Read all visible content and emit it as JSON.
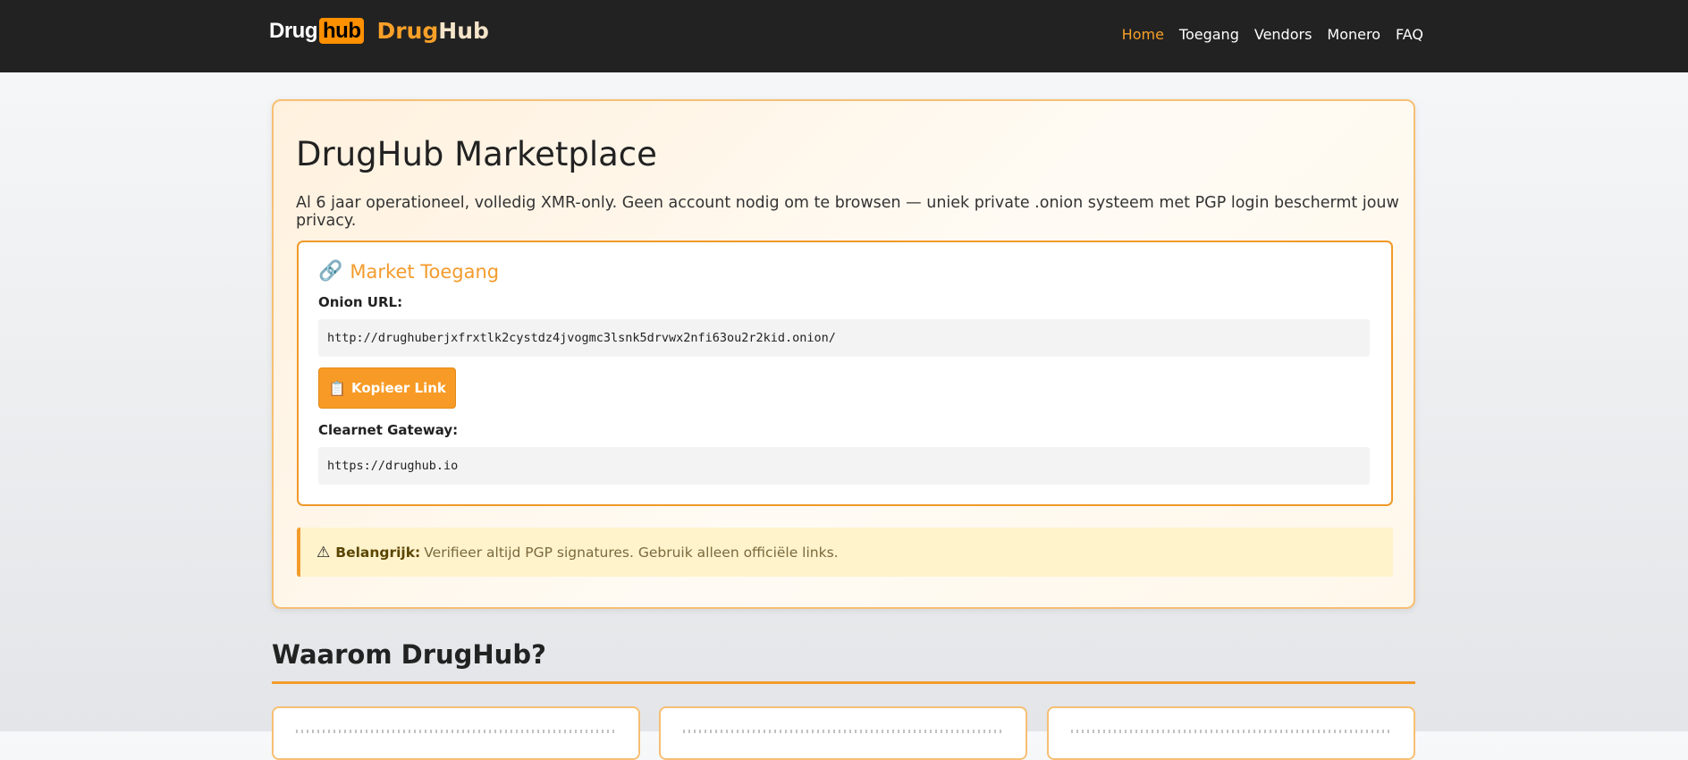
{
  "header": {
    "logo_drug": "Drug",
    "logo_hub": "hub",
    "brand_part1": "Drug",
    "brand_part2": "Hub",
    "nav": [
      {
        "label": "Home",
        "active": true
      },
      {
        "label": "Toegang",
        "active": false
      },
      {
        "label": "Vendors",
        "active": false
      },
      {
        "label": "Monero",
        "active": false
      },
      {
        "label": "FAQ",
        "active": false
      }
    ]
  },
  "hero": {
    "title": "DrugHub Marketplace",
    "lead": "Al 6 jaar operationeel, volledig XMR-only. Geen account nodig om te browsen — uniek private .onion systeem met PGP login beschermt jouw privacy.",
    "access": {
      "icon": "link-icon",
      "title": "Market Toegang",
      "onion_label": "Onion URL:",
      "onion_url": "http://drughuberjxfrxtlk2cystdz4jvogmc3lsnk5drvwx2nfi63ou2r2kid.onion/",
      "copy_icon": "clipboard-icon",
      "copy_label": "Kopieer Link",
      "clearnet_label": "Clearnet Gateway:",
      "clearnet_url": "https://drughub.io"
    },
    "notice": {
      "icon": "warning-icon",
      "strong": "Belangrijk:",
      "text": "Verifieer altijd PGP signatures. Gebruik alleen officiële links."
    }
  },
  "section": {
    "title": "Waarom DrugHub?"
  },
  "colors": {
    "header_bg": "#222222",
    "accent": "#f39b2c",
    "notice_bg": "#fff3cc"
  }
}
